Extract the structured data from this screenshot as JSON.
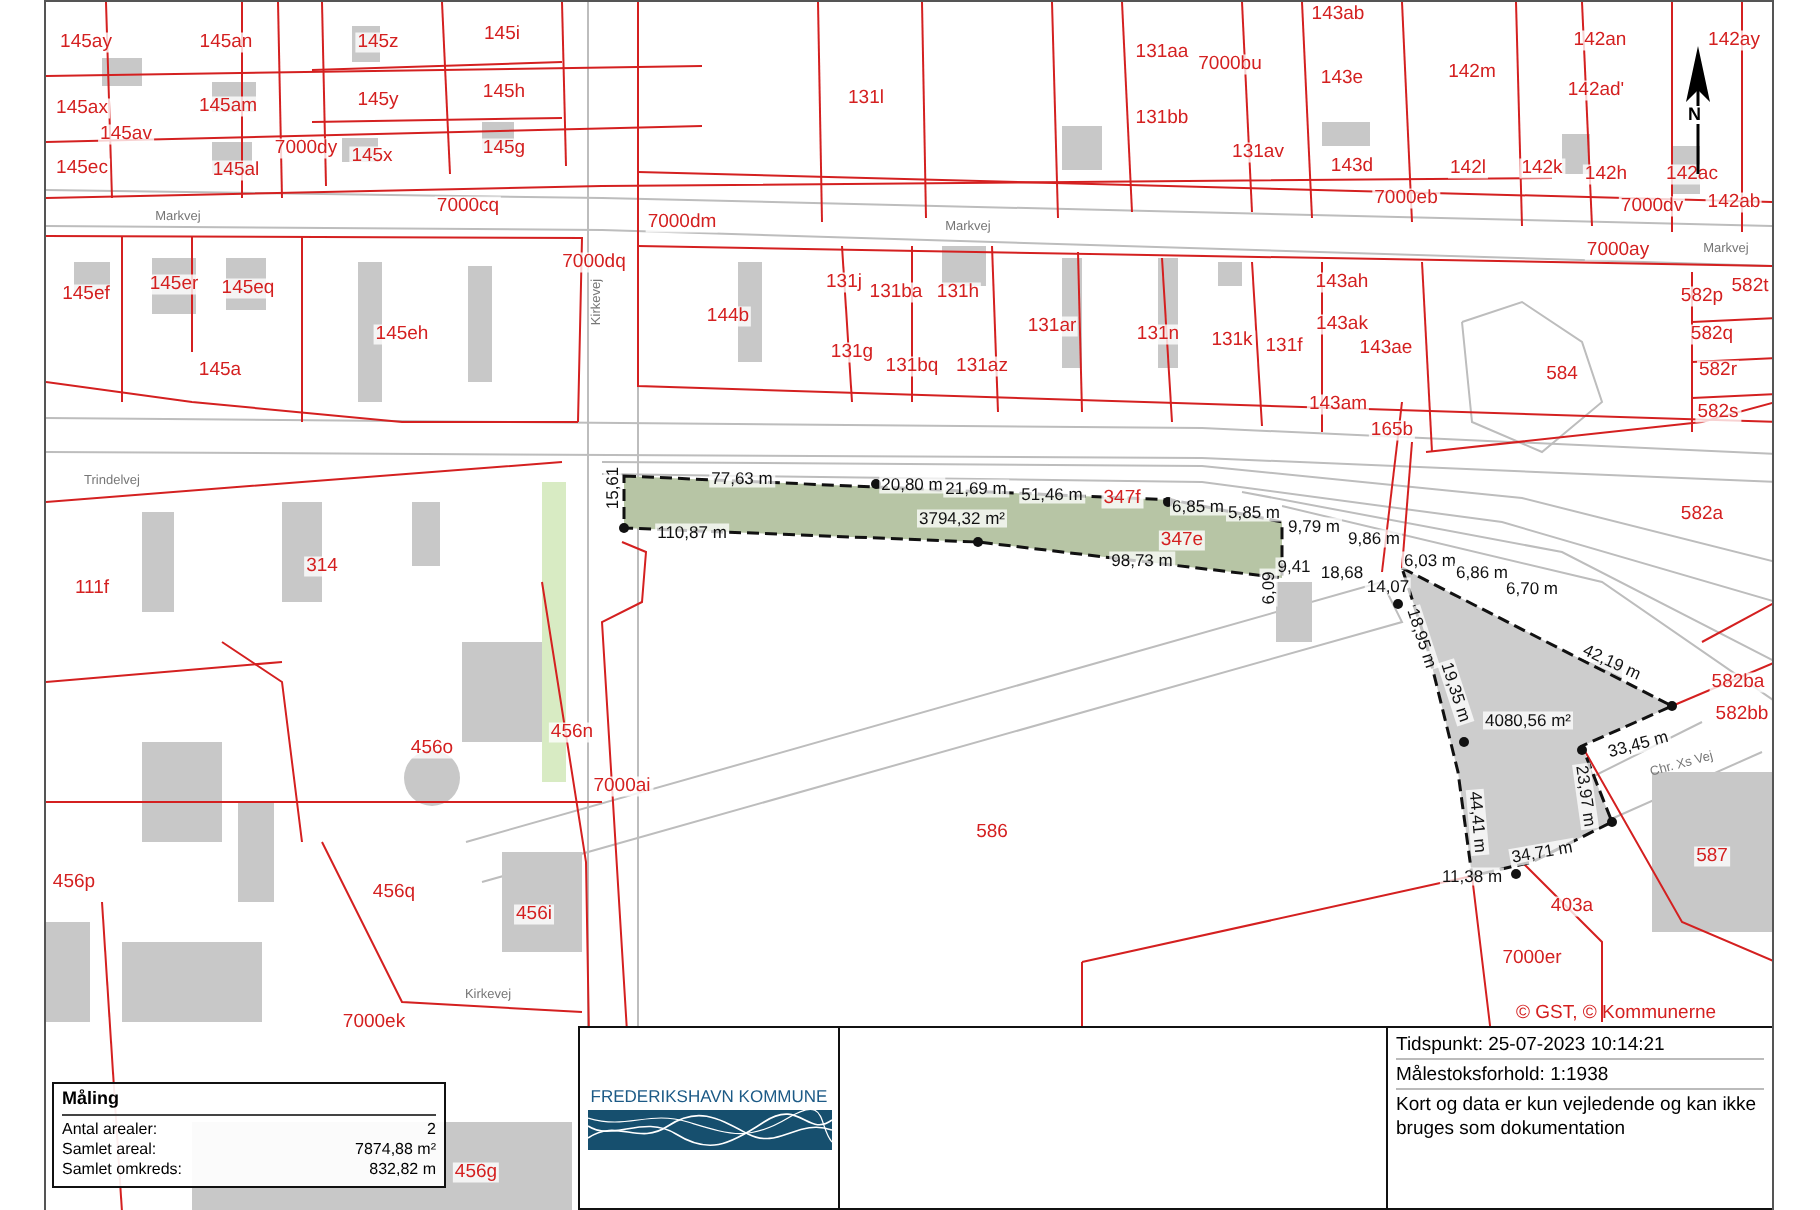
{
  "map_labels": [
    {
      "text": "145ay",
      "kind": "parcel"
    },
    {
      "text": "145an",
      "kind": "parcel"
    },
    {
      "text": "145z",
      "kind": "parcel"
    },
    {
      "text": "145i",
      "kind": "parcel"
    },
    {
      "text": "145ax",
      "kind": "parcel"
    },
    {
      "text": "145am",
      "kind": "parcel"
    },
    {
      "text": "145y",
      "kind": "parcel"
    },
    {
      "text": "145h",
      "kind": "parcel"
    },
    {
      "text": "145av",
      "kind": "parcel"
    },
    {
      "text": "145ec",
      "kind": "parcel"
    },
    {
      "text": "7000dy",
      "kind": "parcel"
    },
    {
      "text": "145al",
      "kind": "parcel"
    },
    {
      "text": "145x",
      "kind": "parcel"
    },
    {
      "text": "145g",
      "kind": "parcel"
    },
    {
      "text": "7000cq",
      "kind": "parcel"
    },
    {
      "text": "131l",
      "kind": "parcel"
    },
    {
      "text": "7000dm",
      "kind": "parcel"
    },
    {
      "text": "7000dq",
      "kind": "parcel"
    },
    {
      "text": "145ef",
      "kind": "parcel"
    },
    {
      "text": "145er",
      "kind": "parcel"
    },
    {
      "text": "145eq",
      "kind": "parcel"
    },
    {
      "text": "145eh",
      "kind": "parcel"
    },
    {
      "text": "145a",
      "kind": "parcel"
    },
    {
      "text": "144b",
      "kind": "parcel"
    },
    {
      "text": "131j",
      "kind": "parcel"
    },
    {
      "text": "131ba",
      "kind": "parcel"
    },
    {
      "text": "131g",
      "kind": "parcel"
    },
    {
      "text": "131bq",
      "kind": "parcel"
    },
    {
      "text": "131h",
      "kind": "parcel"
    },
    {
      "text": "131ar",
      "kind": "parcel"
    },
    {
      "text": "131n",
      "kind": "parcel"
    },
    {
      "text": "131k",
      "kind": "parcel"
    },
    {
      "text": "131f",
      "kind": "parcel"
    },
    {
      "text": "131az",
      "kind": "parcel"
    },
    {
      "text": "131aa",
      "kind": "parcel"
    },
    {
      "text": "7000bu",
      "kind": "parcel"
    },
    {
      "text": "131bb",
      "kind": "parcel"
    },
    {
      "text": "131av",
      "kind": "parcel"
    },
    {
      "text": "143e",
      "kind": "parcel"
    },
    {
      "text": "143d",
      "kind": "parcel"
    },
    {
      "text": "7000eb",
      "kind": "parcel"
    },
    {
      "text": "142m",
      "kind": "parcel"
    },
    {
      "text": "142an",
      "kind": "parcel"
    },
    {
      "text": "142ad'",
      "kind": "parcel"
    },
    {
      "text": "142l",
      "kind": "parcel"
    },
    {
      "text": "142k",
      "kind": "parcel"
    },
    {
      "text": "142h",
      "kind": "parcel"
    },
    {
      "text": "7000dv",
      "kind": "parcel"
    },
    {
      "text": "142ay",
      "kind": "parcel"
    },
    {
      "text": "142ac",
      "kind": "parcel"
    },
    {
      "text": "142ab",
      "kind": "parcel"
    },
    {
      "text": "7000ay",
      "kind": "parcel"
    },
    {
      "text": "143ah",
      "kind": "parcel"
    },
    {
      "text": "143ak",
      "kind": "parcel"
    },
    {
      "text": "143ae",
      "kind": "parcel"
    },
    {
      "text": "143am",
      "kind": "parcel"
    },
    {
      "text": "165b",
      "kind": "parcel"
    },
    {
      "text": "584",
      "kind": "parcel"
    },
    {
      "text": "582p",
      "kind": "parcel"
    },
    {
      "text": "582t",
      "kind": "parcel"
    },
    {
      "text": "582q",
      "kind": "parcel"
    },
    {
      "text": "582r",
      "kind": "parcel"
    },
    {
      "text": "582s",
      "kind": "parcel"
    },
    {
      "text": "347f",
      "kind": "parcel"
    },
    {
      "text": "582a",
      "kind": "parcel"
    },
    {
      "text": "347e",
      "kind": "parcel"
    },
    {
      "text": "582ba",
      "kind": "parcel"
    },
    {
      "text": "582bb",
      "kind": "parcel"
    },
    {
      "text": "586",
      "kind": "parcel"
    },
    {
      "text": "587",
      "kind": "parcel"
    },
    {
      "text": "403a",
      "kind": "parcel"
    },
    {
      "text": "456n",
      "kind": "parcel"
    },
    {
      "text": "7000ai",
      "kind": "parcel"
    },
    {
      "text": "111f",
      "kind": "parcel"
    },
    {
      "text": "314",
      "kind": "parcel"
    },
    {
      "text": "456o",
      "kind": "parcel"
    },
    {
      "text": "456p",
      "kind": "parcel"
    },
    {
      "text": "456q",
      "kind": "parcel"
    },
    {
      "text": "456i",
      "kind": "parcel"
    },
    {
      "text": "7000ek",
      "kind": "parcel"
    },
    {
      "text": "7000er",
      "kind": "parcel"
    },
    {
      "text": "456g",
      "kind": "parcel"
    },
    {
      "text": "143ab",
      "kind": "parcel"
    },
    {
      "text": "77,63 m",
      "kind": "measure"
    },
    {
      "text": "20,80 m",
      "kind": "measure"
    },
    {
      "text": "21,69 m",
      "kind": "measure"
    },
    {
      "text": "51,46 m",
      "kind": "measure"
    },
    {
      "text": "6,85 m",
      "kind": "measure"
    },
    {
      "text": "5,85 m",
      "kind": "measure"
    },
    {
      "text": "9,79 m",
      "kind": "measure"
    },
    {
      "text": "9,86 m",
      "kind": "measure"
    },
    {
      "text": "6,03 m",
      "kind": "measure"
    },
    {
      "text": "6,86 m",
      "kind": "measure"
    },
    {
      "text": "6,70 m",
      "kind": "measure"
    },
    {
      "text": "42,19 m",
      "kind": "measure"
    },
    {
      "text": "15,61",
      "kind": "measure"
    },
    {
      "text": "110,87 m",
      "kind": "measure"
    },
    {
      "text": "3794,32 m²",
      "kind": "measure"
    },
    {
      "text": "98,73 m",
      "kind": "measure"
    },
    {
      "text": "9,41",
      "kind": "measure"
    },
    {
      "text": "18,68",
      "kind": "measure"
    },
    {
      "text": "14,07",
      "kind": "measure"
    },
    {
      "text": "6,09",
      "kind": "measure"
    },
    {
      "text": "18,95 m",
      "kind": "measure"
    },
    {
      "text": "19,35 m",
      "kind": "measure"
    },
    {
      "text": "4080,56 m²",
      "kind": "measure"
    },
    {
      "text": "33,45 m",
      "kind": "measure"
    },
    {
      "text": "23,97 m",
      "kind": "measure"
    },
    {
      "text": "44,41 m",
      "kind": "measure"
    },
    {
      "text": "34,71 m",
      "kind": "measure"
    },
    {
      "text": "11,38 m",
      "kind": "measure"
    },
    {
      "text": "Markvej",
      "kind": "street"
    },
    {
      "text": "Markvej",
      "kind": "street"
    },
    {
      "text": "Kirkevej",
      "kind": "street"
    },
    {
      "text": "Trindelvej",
      "kind": "street"
    },
    {
      "text": "Chr. Xs Vej",
      "kind": "street"
    },
    {
      "text": "Kirkevej",
      "kind": "street"
    },
    {
      "text": "Markvej",
      "kind": "street"
    }
  ],
  "north_arrow": {
    "label": "N"
  },
  "copyright": "© GST, © Kommunerne",
  "measurement": {
    "title": "Måling",
    "rows": [
      {
        "label": "Antal arealer:",
        "value": "2"
      },
      {
        "label": "Samlet areal:",
        "value": "7874,88 m²"
      },
      {
        "label": "Samlet omkreds:",
        "value": "832,82 m"
      }
    ]
  },
  "logo": {
    "name": "FREDERIKSHAVN KOMMUNE"
  },
  "info": {
    "timestamp": "Tidspunkt: 25-07-2023 10:14:21",
    "scale": "Målestoksforhold: 1:1938",
    "disclaimer": "Kort og data er kun vejledende og kan ikke bruges som dokumentation"
  }
}
